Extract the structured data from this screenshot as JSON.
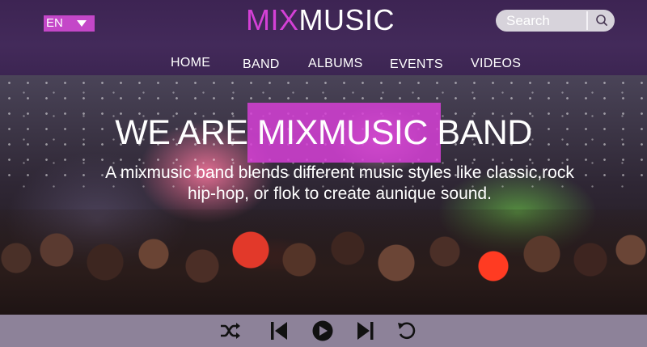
{
  "header": {
    "language": "EN",
    "logo": {
      "mix": "MIX",
      "music": "MUSIC"
    },
    "search": {
      "placeholder": "Search"
    },
    "nav": [
      "HOME",
      "BAND",
      "ALBUMS",
      "EVENTS",
      "VIDEOS"
    ]
  },
  "hero": {
    "title": "WE ARE MIXMUSIC BAND",
    "text_line1": "A mixmusic band blends  different music styles like classic,rock",
    "text_line2": "hip-hop, or flok to create aunique sound."
  },
  "player": {
    "controls": [
      "shuffle-icon",
      "previous-icon",
      "play-icon",
      "next-icon",
      "repeat-icon"
    ]
  },
  "colors": {
    "header_bg": "#3d2453",
    "accent": "#d440d6",
    "player_bg": "#8d8299"
  }
}
